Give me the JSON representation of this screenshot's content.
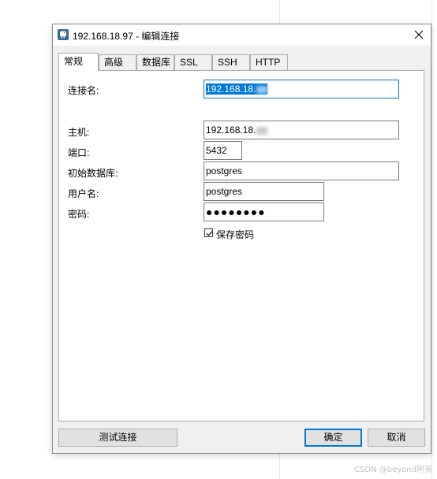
{
  "window": {
    "title": "192.168.18.97 - 编辑连接",
    "icon": "postgresql-elephant-icon",
    "close_icon": "close-icon"
  },
  "tabs": [
    {
      "label": "常规",
      "active": true
    },
    {
      "label": "高级",
      "active": false
    },
    {
      "label": "数据库",
      "active": false
    },
    {
      "label": "SSL",
      "active": false
    },
    {
      "label": "SSH",
      "active": false
    },
    {
      "label": "HTTP",
      "active": false
    }
  ],
  "form": {
    "connection_name": {
      "label": "连接名:",
      "value": "192.168.18."
    },
    "host": {
      "label": "主机:",
      "value": "192.168.18."
    },
    "port": {
      "label": "端口:",
      "value": "5432"
    },
    "initial_database": {
      "label": "初始数据库:",
      "value": "postgres"
    },
    "username": {
      "label": "用户名:",
      "value": "postgres"
    },
    "password": {
      "label": "密码:",
      "value": "●●●●●●●●"
    },
    "save_password": {
      "label": "保存密码",
      "checked": true
    }
  },
  "buttons": {
    "test": "测试连接",
    "ok": "确定",
    "cancel": "取消"
  },
  "watermark": "CSDN @beyond阿亮",
  "colors": {
    "accent": "#0078d7",
    "dialog_bg": "#f0f0f0",
    "button_bg": "#e1e1e1"
  }
}
